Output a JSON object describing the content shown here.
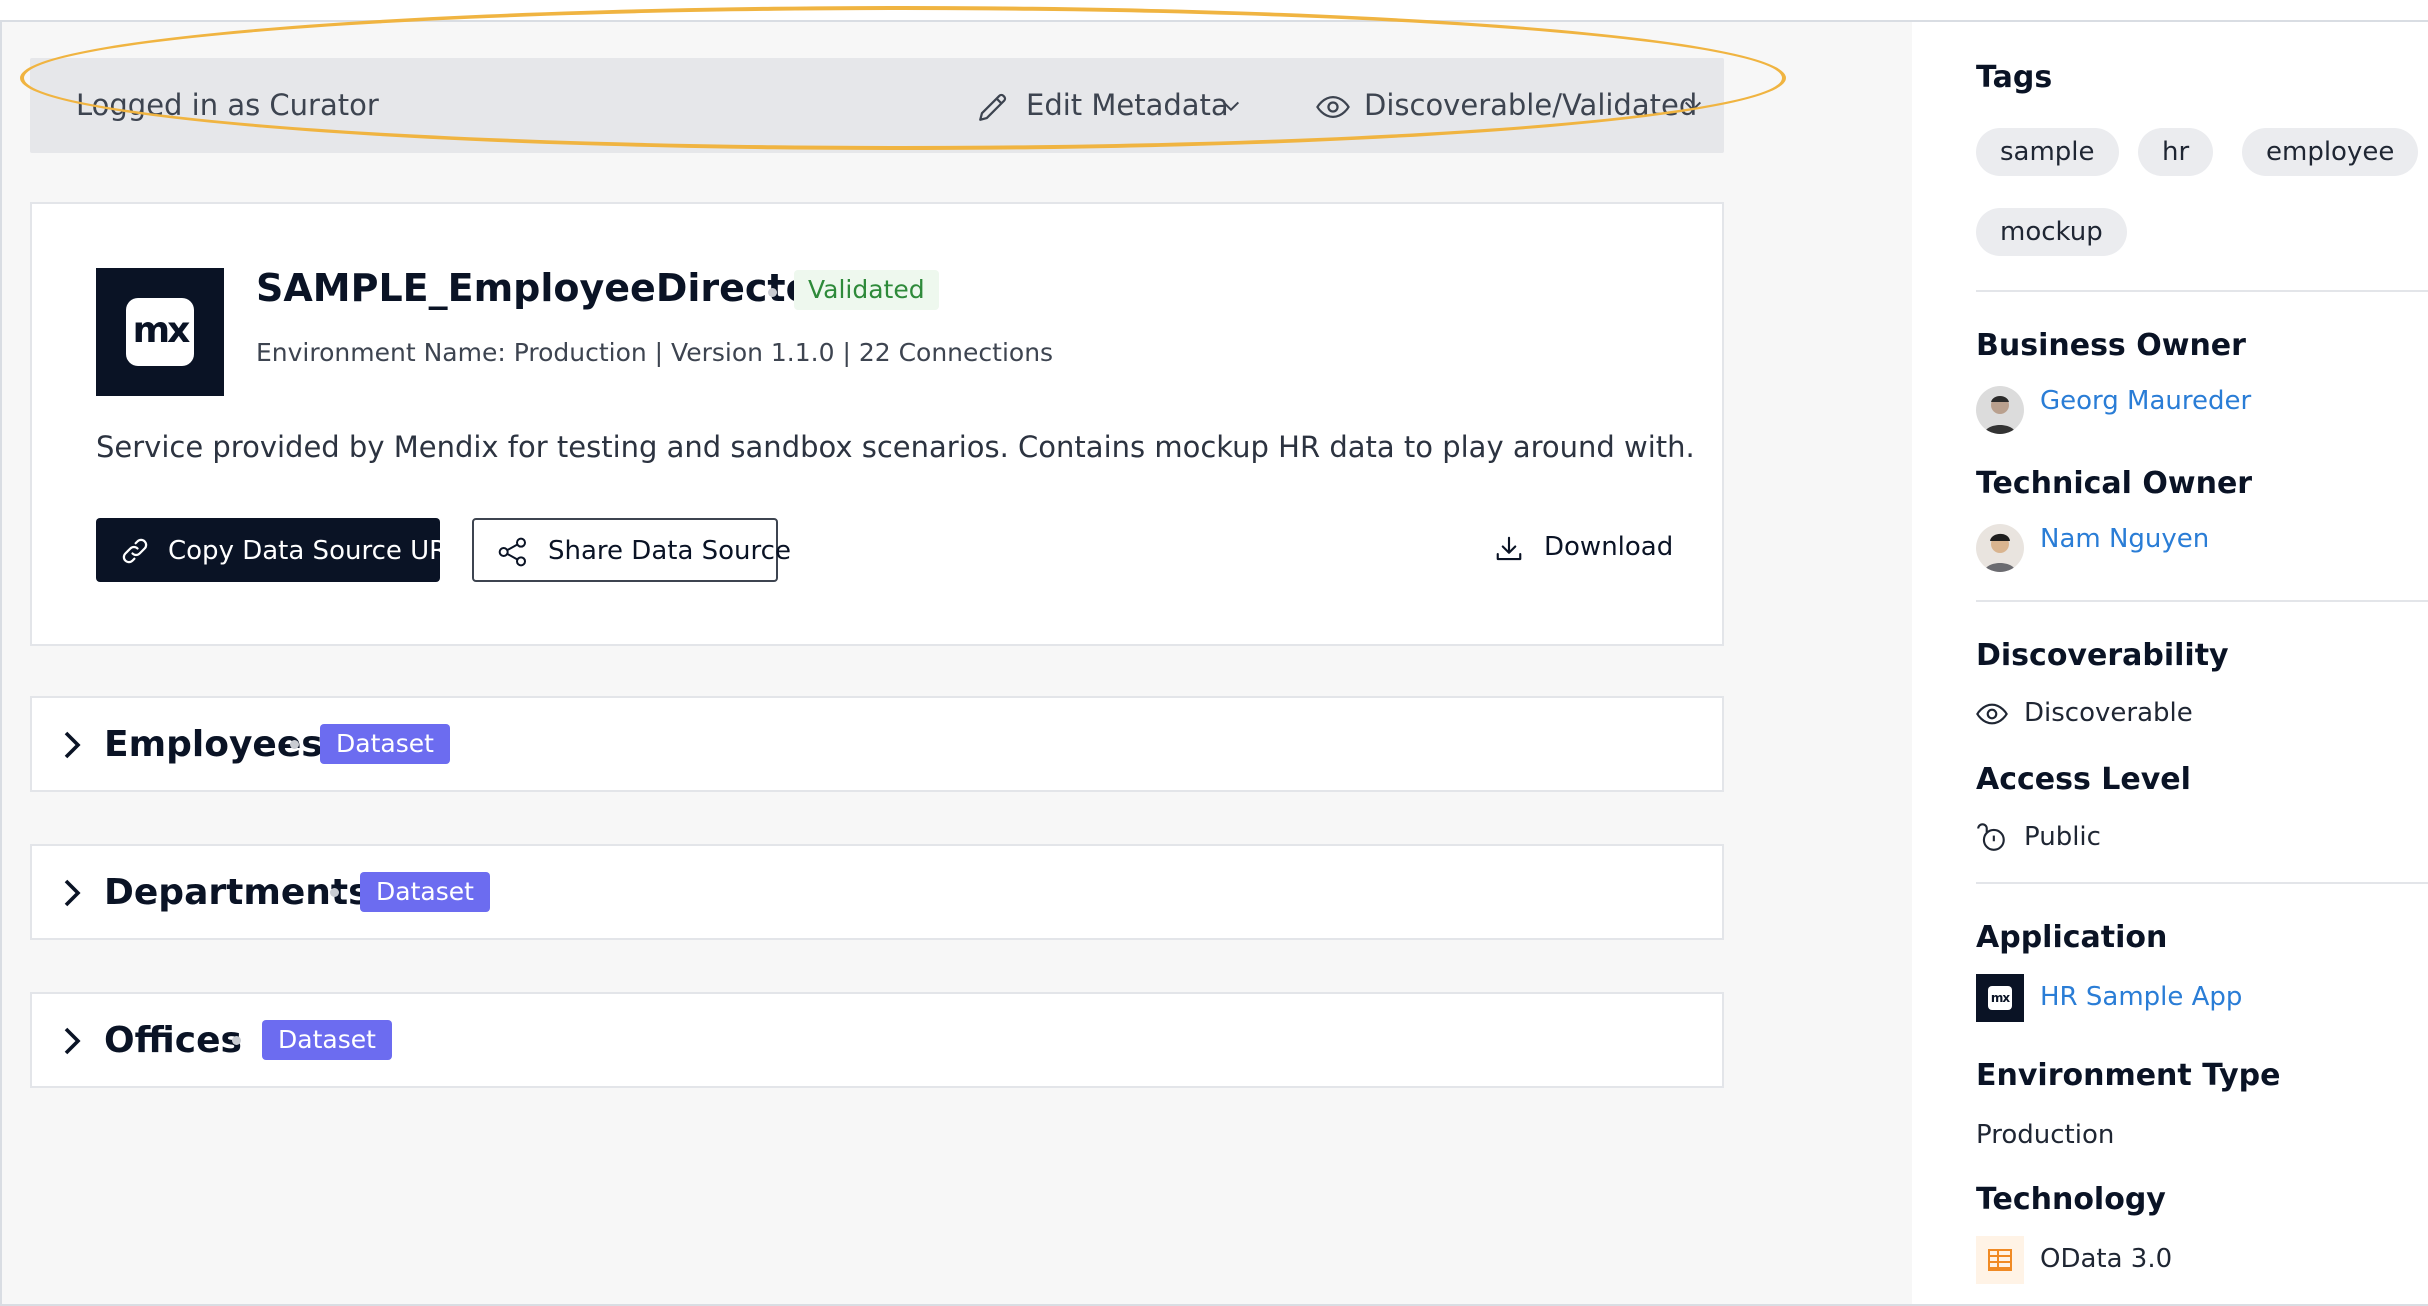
{
  "topbar": {
    "logged_in": "Logged in as Curator",
    "edit_metadata": "Edit Metadata",
    "discoverable_validated": "Discoverable/Validated"
  },
  "source": {
    "logo_text": "mx",
    "name": "SAMPLE_EmployeeDirectory",
    "status": "Validated",
    "meta": "Environment Name: Production | Version 1.1.0 | 22 Connections",
    "description": "Service provided by Mendix for testing and sandbox scenarios. Contains mockup HR data to play around with.",
    "copy_uri_label": "Copy Data Source URI",
    "share_label": "Share Data Source",
    "download_label": "Download"
  },
  "datasets": [
    {
      "name": "Employees",
      "badge": "Dataset"
    },
    {
      "name": "Departments",
      "badge": "Dataset"
    },
    {
      "name": "Offices",
      "badge": "Dataset"
    }
  ],
  "sidebar": {
    "tags_heading": "Tags",
    "tags": [
      "sample",
      "hr",
      "employee",
      "mockup"
    ],
    "business_owner_heading": "Business Owner",
    "business_owner": "Georg Maureder",
    "technical_owner_heading": "Technical Owner",
    "technical_owner": "Nam Nguyen",
    "discoverability_heading": "Discoverability",
    "discoverability": "Discoverable",
    "access_level_heading": "Access Level",
    "access_level": "Public",
    "application_heading": "Application",
    "application": "HR Sample App",
    "environment_type_heading": "Environment Type",
    "environment_type": "Production",
    "technology_heading": "Technology",
    "technology": "OData 3.0"
  },
  "colors": {
    "highlight": "#f0b441",
    "dark": "#0a1325",
    "badge": "#6c6cf0",
    "link": "#2a7dd6",
    "validated_bg": "#eef8ee",
    "validated_text": "#2e8a3a"
  }
}
